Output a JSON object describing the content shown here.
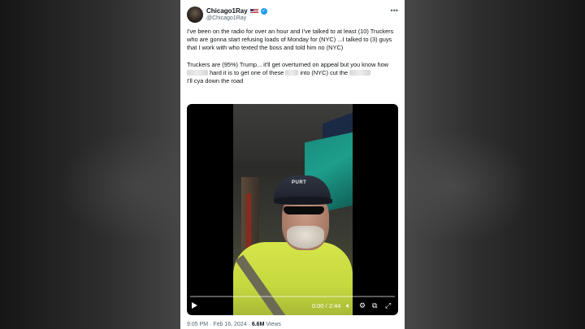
{
  "tweet": {
    "author": {
      "display_name": "Chicago1Ray",
      "handle": "@Chicago1Ray",
      "flag_icon": "us-flag-icon",
      "verified_icon": "verified-badge-icon"
    },
    "menu_icon": "more-icon",
    "text": {
      "line1": "I've been on the radio for over an hour and I've talked to at least (10) Truckers who are gonna start refusing loads of Monday for (NYC) ...I talked to (3) guys that I work with who texted the boss and told him no (NYC)",
      "line2_a": "Truckers are (95%) Trump... it'll get overturned on appeal but you know how",
      "line2_b": "hard it is to get one of these",
      "line2_c": "into (NYC) cut the",
      "line2_d": "I'll cya down the road"
    },
    "video": {
      "cap_text": "PURT",
      "time": "0:00 / 2:44",
      "progress": 0.0,
      "controls": [
        "play-icon",
        "volume-icon",
        "settings-icon",
        "pip-icon",
        "fullscreen-icon"
      ]
    },
    "meta": {
      "time": "9:05 PM",
      "separator": "·",
      "date": "Feb 16, 2024",
      "views_count": "6.6M",
      "views_label": "Views"
    }
  },
  "colors": {
    "text_primary": "#0f1419",
    "text_secondary": "#536471",
    "verified_blue": "#1d9bf0"
  }
}
